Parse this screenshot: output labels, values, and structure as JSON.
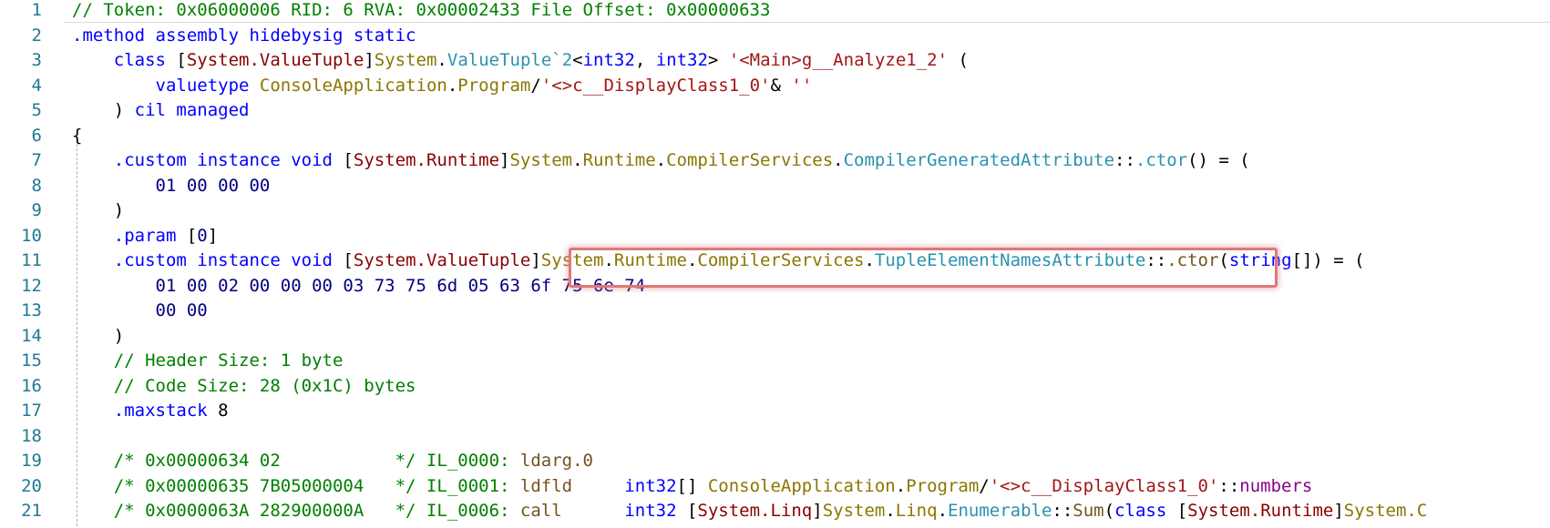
{
  "colors": {
    "comment": "#008000",
    "keyword": "#0000ff",
    "namespace": "#8b0000",
    "type": "#8a7600",
    "class": "#2b91af",
    "string": "#a31515",
    "number": "#000080",
    "line_number": "#237893",
    "highlight_box": "#e0787a"
  },
  "lines": [
    {
      "num": "1",
      "tokens": [
        {
          "t": "// Token: 0x06000006 RID: 6 RVA: 0x00002433 File Offset: 0x00000633",
          "c": "com"
        }
      ]
    },
    {
      "num": "2",
      "tokens": [
        {
          "t": ".method assembly hidebysig static",
          "c": "kw"
        }
      ]
    },
    {
      "num": "3",
      "tokens": [
        {
          "t": "    ",
          "c": "punct"
        },
        {
          "t": "class",
          "c": "kw"
        },
        {
          "t": " [",
          "c": "punct"
        },
        {
          "t": "System.ValueTuple",
          "c": "ns"
        },
        {
          "t": "]",
          "c": "punct"
        },
        {
          "t": "System",
          "c": "type"
        },
        {
          "t": ".",
          "c": "punct"
        },
        {
          "t": "ValueTuple`2",
          "c": "class"
        },
        {
          "t": "<",
          "c": "punct"
        },
        {
          "t": "int32",
          "c": "kw"
        },
        {
          "t": ", ",
          "c": "punct"
        },
        {
          "t": "int32",
          "c": "kw"
        },
        {
          "t": "> ",
          "c": "punct"
        },
        {
          "t": "'<Main>g__Analyze1_2'",
          "c": "str"
        },
        {
          "t": " (",
          "c": "punct"
        }
      ]
    },
    {
      "num": "4",
      "tokens": [
        {
          "t": "        ",
          "c": "punct"
        },
        {
          "t": "valuetype",
          "c": "kw"
        },
        {
          "t": " ",
          "c": "punct"
        },
        {
          "t": "ConsoleApplication",
          "c": "type"
        },
        {
          "t": ".",
          "c": "punct"
        },
        {
          "t": "Program",
          "c": "type"
        },
        {
          "t": "/",
          "c": "punct"
        },
        {
          "t": "'<>c__DisplayClass1_0'",
          "c": "str"
        },
        {
          "t": "& ",
          "c": "punct"
        },
        {
          "t": "''",
          "c": "str"
        }
      ]
    },
    {
      "num": "5",
      "tokens": [
        {
          "t": "    ) ",
          "c": "punct"
        },
        {
          "t": "cil managed",
          "c": "kw"
        }
      ]
    },
    {
      "num": "6",
      "tokens": [
        {
          "t": "{",
          "c": "punct"
        }
      ]
    },
    {
      "num": "7",
      "tokens": [
        {
          "t": "    ",
          "c": "punct"
        },
        {
          "t": ".custom instance void",
          "c": "kw"
        },
        {
          "t": " [",
          "c": "punct"
        },
        {
          "t": "System.Runtime",
          "c": "ns"
        },
        {
          "t": "]",
          "c": "punct"
        },
        {
          "t": "System",
          "c": "type"
        },
        {
          "t": ".",
          "c": "punct"
        },
        {
          "t": "Runtime",
          "c": "type"
        },
        {
          "t": ".",
          "c": "punct"
        },
        {
          "t": "CompilerServices",
          "c": "type"
        },
        {
          "t": ".",
          "c": "punct"
        },
        {
          "t": "CompilerGeneratedAttribute",
          "c": "class"
        },
        {
          "t": "::",
          "c": "punct"
        },
        {
          "t": ".ctor",
          "c": "class"
        },
        {
          "t": "() = (",
          "c": "punct"
        }
      ]
    },
    {
      "num": "8",
      "tokens": [
        {
          "t": "        ",
          "c": "punct"
        },
        {
          "t": "01 00 00 00",
          "c": "hex"
        }
      ]
    },
    {
      "num": "9",
      "tokens": [
        {
          "t": "    )",
          "c": "punct"
        }
      ]
    },
    {
      "num": "10",
      "tokens": [
        {
          "t": "    ",
          "c": "punct"
        },
        {
          "t": ".param",
          "c": "kw"
        },
        {
          "t": " [",
          "c": "punct"
        },
        {
          "t": "0",
          "c": "hex"
        },
        {
          "t": "]",
          "c": "punct"
        }
      ]
    },
    {
      "num": "11",
      "tokens": [
        {
          "t": "    ",
          "c": "punct"
        },
        {
          "t": ".custom instance void",
          "c": "kw"
        },
        {
          "t": " [",
          "c": "punct"
        },
        {
          "t": "System.ValueTuple",
          "c": "ns"
        },
        {
          "t": "]",
          "c": "punct"
        },
        {
          "t": "System",
          "c": "type"
        },
        {
          "t": ".",
          "c": "punct"
        },
        {
          "t": "Runtime",
          "c": "type"
        },
        {
          "t": ".",
          "c": "punct"
        },
        {
          "t": "CompilerServices",
          "c": "type"
        },
        {
          "t": ".",
          "c": "punct"
        },
        {
          "t": "TupleElementNamesAttribute",
          "c": "class"
        },
        {
          "t": "::",
          "c": "punct"
        },
        {
          "t": ".ctor",
          "c": "ctor"
        },
        {
          "t": "(",
          "c": "punct"
        },
        {
          "t": "string",
          "c": "kw"
        },
        {
          "t": "[]) = (",
          "c": "punct"
        }
      ]
    },
    {
      "num": "12",
      "tokens": [
        {
          "t": "        ",
          "c": "punct"
        },
        {
          "t": "01 00 02 00 00 00 03 73 75 6d 05 63 6f 75 6e 74",
          "c": "hex"
        }
      ]
    },
    {
      "num": "13",
      "tokens": [
        {
          "t": "        ",
          "c": "punct"
        },
        {
          "t": "00 00",
          "c": "hex"
        }
      ]
    },
    {
      "num": "14",
      "tokens": [
        {
          "t": "    )",
          "c": "punct"
        }
      ]
    },
    {
      "num": "15",
      "tokens": [
        {
          "t": "    ",
          "c": "punct"
        },
        {
          "t": "// Header Size: 1 byte",
          "c": "com"
        }
      ]
    },
    {
      "num": "16",
      "tokens": [
        {
          "t": "    ",
          "c": "punct"
        },
        {
          "t": "// Code Size: 28 (0x1C) bytes",
          "c": "com"
        }
      ]
    },
    {
      "num": "17",
      "tokens": [
        {
          "t": "    ",
          "c": "punct"
        },
        {
          "t": ".maxstack",
          "c": "kw"
        },
        {
          "t": " 8",
          "c": "punct"
        }
      ]
    },
    {
      "num": "18",
      "tokens": []
    },
    {
      "num": "19",
      "tokens": [
        {
          "t": "    ",
          "c": "punct"
        },
        {
          "t": "/* 0x00000634 02           */ IL_0000:",
          "c": "com"
        },
        {
          "t": " ",
          "c": "punct"
        },
        {
          "t": "ldarg.0",
          "c": "ctor"
        }
      ]
    },
    {
      "num": "20",
      "tokens": [
        {
          "t": "    ",
          "c": "punct"
        },
        {
          "t": "/* 0x00000635 7B05000004   */ IL_0001:",
          "c": "com"
        },
        {
          "t": " ",
          "c": "punct"
        },
        {
          "t": "ldfld",
          "c": "ctor"
        },
        {
          "t": "     ",
          "c": "punct"
        },
        {
          "t": "int32",
          "c": "kw"
        },
        {
          "t": "[] ",
          "c": "punct"
        },
        {
          "t": "ConsoleApplication",
          "c": "type"
        },
        {
          "t": ".",
          "c": "punct"
        },
        {
          "t": "Program",
          "c": "type"
        },
        {
          "t": "/",
          "c": "punct"
        },
        {
          "t": "'<>c__DisplayClass1_0'",
          "c": "str"
        },
        {
          "t": "::",
          "c": "punct"
        },
        {
          "t": "numbers",
          "c": "fld"
        }
      ]
    },
    {
      "num": "21",
      "tokens": [
        {
          "t": "    ",
          "c": "punct"
        },
        {
          "t": "/* 0x0000063A 282900000A   */ IL_0006:",
          "c": "com"
        },
        {
          "t": " ",
          "c": "punct"
        },
        {
          "t": "call",
          "c": "ctor"
        },
        {
          "t": "      ",
          "c": "punct"
        },
        {
          "t": "int32",
          "c": "kw"
        },
        {
          "t": " [",
          "c": "punct"
        },
        {
          "t": "System.Linq",
          "c": "ns"
        },
        {
          "t": "]",
          "c": "punct"
        },
        {
          "t": "System",
          "c": "type"
        },
        {
          "t": ".",
          "c": "punct"
        },
        {
          "t": "Linq",
          "c": "type"
        },
        {
          "t": ".",
          "c": "punct"
        },
        {
          "t": "Enumerable",
          "c": "class"
        },
        {
          "t": "::",
          "c": "punct"
        },
        {
          "t": "Sum",
          "c": "mth"
        },
        {
          "t": "(",
          "c": "punct"
        },
        {
          "t": "class",
          "c": "kw"
        },
        {
          "t": " [",
          "c": "punct"
        },
        {
          "t": "System.Runtime",
          "c": "ns"
        },
        {
          "t": "]",
          "c": "punct"
        },
        {
          "t": "System.C",
          "c": "type"
        }
      ]
    }
  ]
}
